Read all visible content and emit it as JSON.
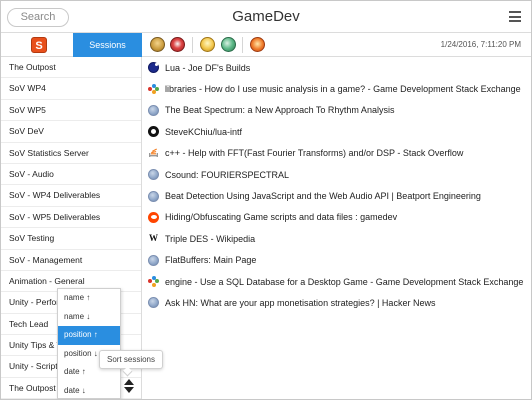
{
  "header": {
    "search_placeholder": "Search",
    "title": "GameDev"
  },
  "sidebar": {
    "logo_letter": "S",
    "sessions_tab": "Sessions",
    "items": [
      "The Outpost",
      "SoV WP4",
      "SoV WP5",
      "SoV DeV",
      "SoV Statistics Server",
      "SoV - Audio",
      "SoV - WP4 Deliverables",
      "SoV - WP5 Deliverables",
      "SoV Testing",
      "SoV - Management",
      "Animation - General",
      "Unity - Performance",
      "Tech Lead",
      "Unity Tips & Tricks",
      "Unity - Scripting",
      "The Outpost"
    ]
  },
  "sort_menu": {
    "options": [
      "name ↑",
      "name ↓",
      "position ↑",
      "position ↓",
      "date ↑",
      "date ↓"
    ],
    "selected_index": 2,
    "tooltip": "Sort sessions"
  },
  "toolbar": {
    "icons": [
      "stack-icon",
      "window-icon",
      "figure-icon",
      "planet-icon",
      "star-icon"
    ],
    "timestamp": "1/24/2016, 7:11:20 PM"
  },
  "tabs": [
    {
      "icon": "lua",
      "title": "Lua - Joe DF's Builds"
    },
    {
      "icon": "se",
      "title": "libraries - How do I use music analysis in a game? - Game Development Stack Exchange"
    },
    {
      "icon": "globe",
      "title": "The Beat Spectrum: a New Approach To Rhythm Analysis"
    },
    {
      "icon": "github",
      "title": "SteveKChiu/lua-intf"
    },
    {
      "icon": "cpp",
      "title": "c++ - Help with FFT(Fast Fourier Transforms) and/or DSP - Stack Overflow"
    },
    {
      "icon": "globe",
      "title": "Csound: FOURIERSPECTRAL"
    },
    {
      "icon": "globe",
      "title": "Beat Detection Using JavaScript and the Web Audio API | Beatport Engineering"
    },
    {
      "icon": "reddit",
      "title": "Hiding/Obfuscating Game scripts and data files : gamedev"
    },
    {
      "icon": "wiki",
      "title": "Triple DES - Wikipedia"
    },
    {
      "icon": "globe",
      "title": "FlatBuffers: Main Page"
    },
    {
      "icon": "se",
      "title": "engine - Use a SQL Database for a Desktop Game - Game Development Stack Exchange"
    },
    {
      "icon": "globe",
      "title": "Ask HN: What are your app monetisation strategies? | Hacker News"
    }
  ]
}
